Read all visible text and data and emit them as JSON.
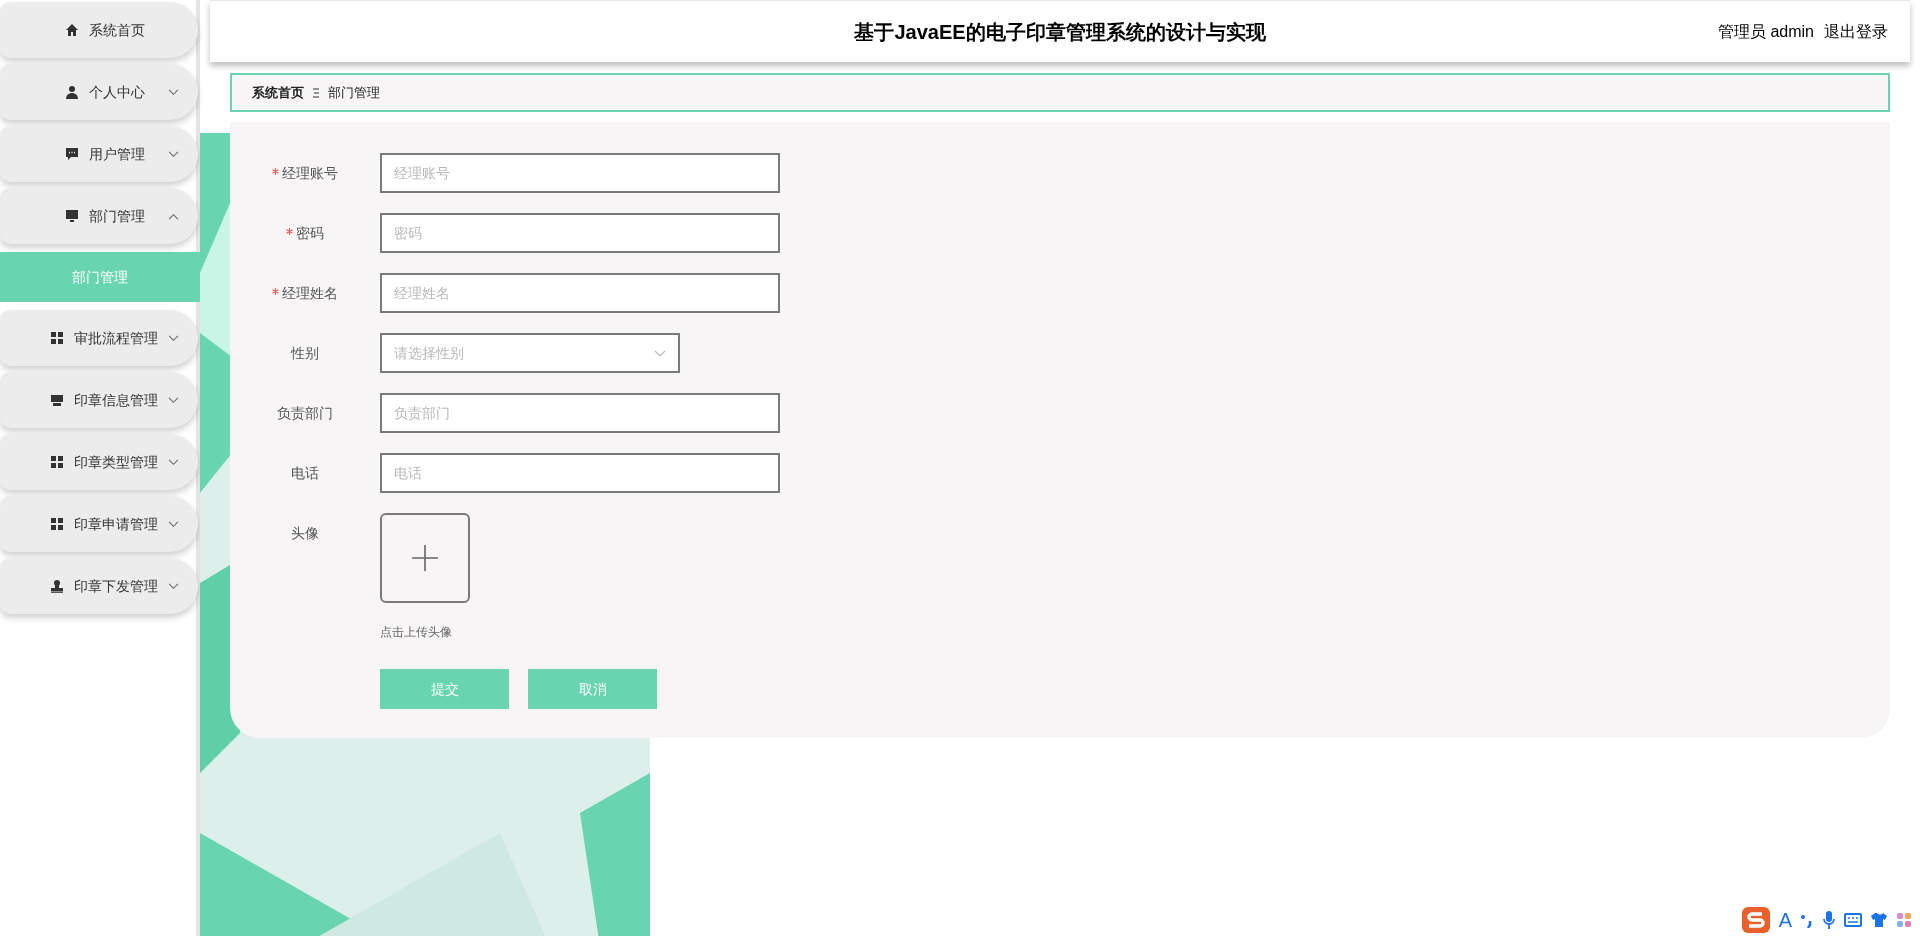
{
  "sidebar": {
    "items": [
      {
        "kind": "link",
        "label": "系统首页"
      },
      {
        "kind": "menu",
        "label": "个人中心",
        "expanded": false
      },
      {
        "kind": "menu",
        "label": "用户管理",
        "expanded": false
      },
      {
        "kind": "menu",
        "label": "部门管理",
        "expanded": true,
        "children": [
          {
            "label": "部门管理",
            "selected": true
          }
        ]
      },
      {
        "kind": "menu",
        "label": "审批流程管理",
        "expanded": false
      },
      {
        "kind": "menu",
        "label": "印章信息管理",
        "expanded": false
      },
      {
        "kind": "menu",
        "label": "印章类型管理",
        "expanded": false
      },
      {
        "kind": "menu",
        "label": "印章申请管理",
        "expanded": false
      },
      {
        "kind": "menu",
        "label": "印章下发管理",
        "expanded": false
      }
    ]
  },
  "header": {
    "title": "基于JavaEE的电子印章管理系统的设计与实现",
    "user": "管理员 admin",
    "logout": "退出登录"
  },
  "breadcrumb": [
    "系统首页",
    "部门管理"
  ],
  "form": {
    "fields": [
      {
        "kind": "text",
        "label": "经理账号",
        "required": true,
        "placeholder": "经理账号"
      },
      {
        "kind": "text",
        "label": "密码",
        "required": true,
        "placeholder": "密码"
      },
      {
        "kind": "text",
        "label": "经理姓名",
        "required": true,
        "placeholder": "经理姓名"
      },
      {
        "kind": "select",
        "label": "性别",
        "required": false,
        "placeholder": "请选择性别"
      },
      {
        "kind": "text",
        "label": "负责部门",
        "required": false,
        "placeholder": "负责部门"
      },
      {
        "kind": "text",
        "label": "电话",
        "required": false,
        "placeholder": "电话"
      },
      {
        "kind": "upload",
        "label": "头像",
        "required": false,
        "hint": "点击上传头像"
      }
    ],
    "buttons": [
      "提交",
      "取消"
    ]
  },
  "ime_bar": {
    "mode": "A"
  }
}
